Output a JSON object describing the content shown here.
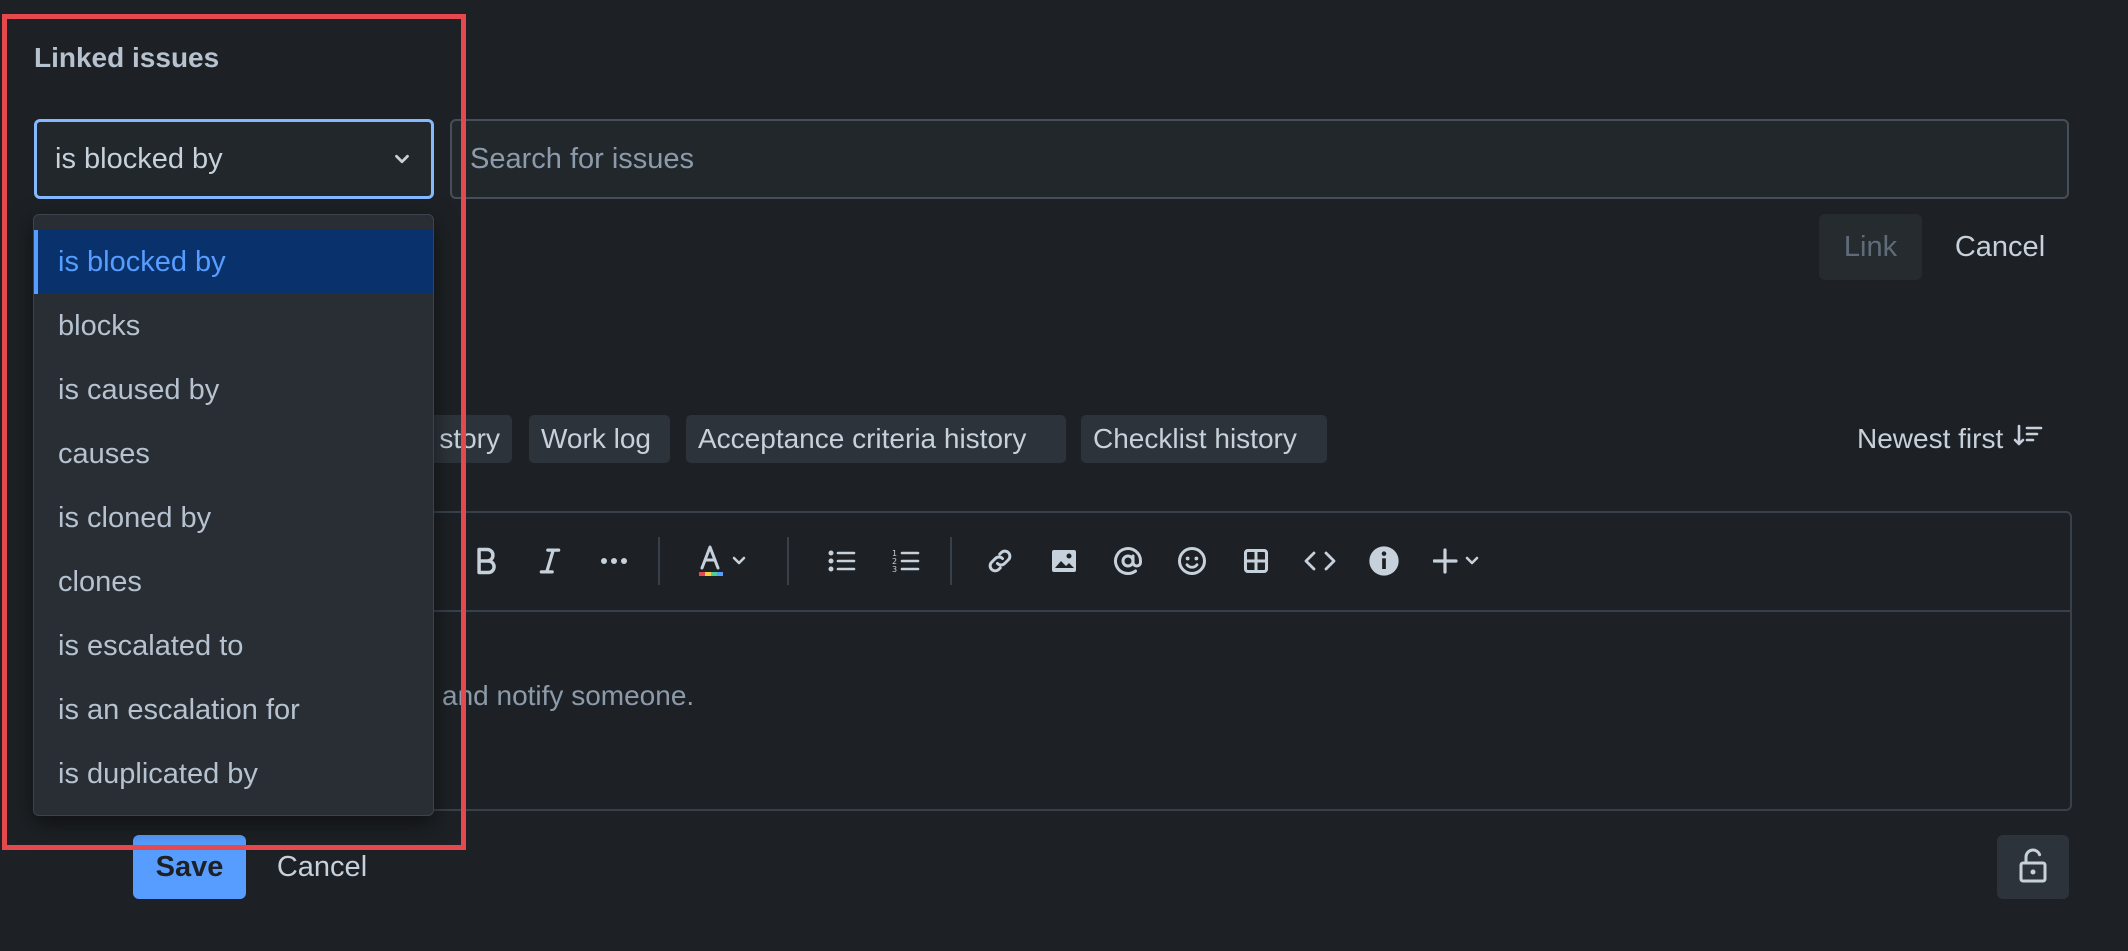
{
  "linked_issues": {
    "title": "Linked issues",
    "link_type_selected": "is blocked by",
    "search_placeholder": "Search for issues",
    "link_button": "Link",
    "cancel_button": "Cancel",
    "dropdown_options": [
      "is blocked by",
      "blocks",
      "is caused by",
      "causes",
      "is cloned by",
      "clones",
      "is escalated to",
      "is an escalation for",
      "is duplicated by"
    ]
  },
  "activity": {
    "tabs": [
      "story",
      "Work log",
      "Acceptance criteria history",
      "Checklist history"
    ],
    "sort_label": "Newest first"
  },
  "comment_editor": {
    "placeholder_visible": "and notify someone.",
    "toolbar_icons": [
      "bold-icon",
      "italic-icon",
      "more-formatting-icon",
      "text-color-icon",
      "bullet-list-icon",
      "numbered-list-icon",
      "link-icon",
      "image-icon",
      "mention-icon",
      "emoji-icon",
      "table-icon",
      "code-icon",
      "info-panel-icon",
      "insert-plus-icon"
    ],
    "save_button": "Save",
    "cancel_button": "Cancel"
  },
  "colors": {
    "background": "#1d2125",
    "accent": "#579dff",
    "selected_option_bg": "#09326c",
    "highlight_border": "#e5484d"
  }
}
